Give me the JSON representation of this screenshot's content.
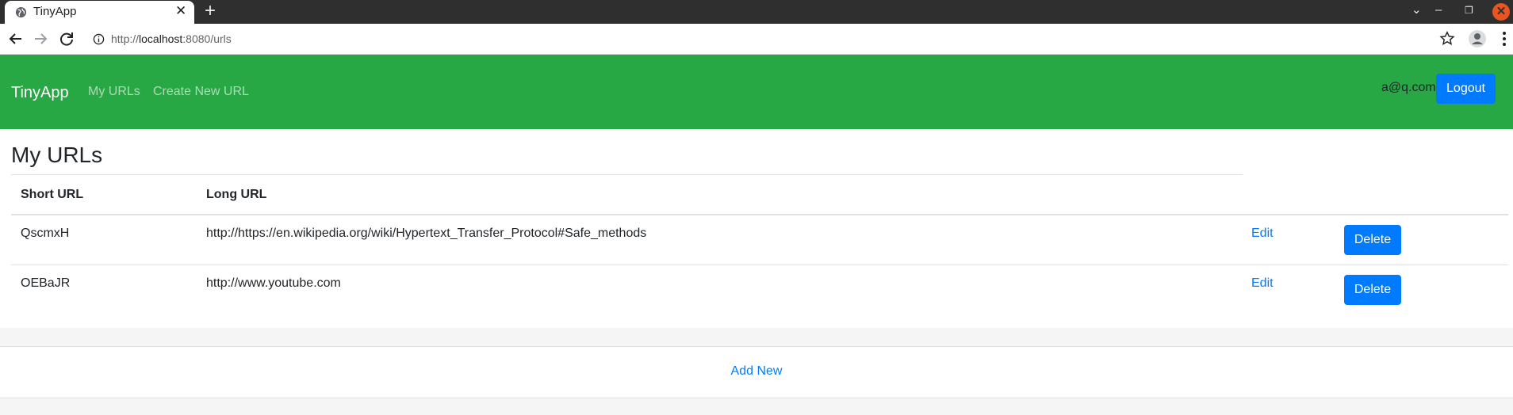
{
  "browser": {
    "tab_title": "TinyApp",
    "tab_close": "✕",
    "new_tab": "+",
    "url_scheme": "http://",
    "url_host": "localhost",
    "url_rest": ":8080/urls",
    "window_controls": {
      "dropdown": "⌄",
      "minimize": "–",
      "restore": "❐",
      "close": "✕"
    }
  },
  "navbar": {
    "brand": "TinyApp",
    "links": [
      "My URLs",
      "Create New URL"
    ],
    "user_email": "a@q.com",
    "logout_label": "Logout",
    "color": "#28a745"
  },
  "main": {
    "heading": "My URLs",
    "columns": [
      "Short URL",
      "Long URL"
    ],
    "rows": [
      {
        "short": "QscmxH",
        "long": "http://https://en.wikipedia.org/wiki/Hypertext_Transfer_Protocol#Safe_methods",
        "edit": "Edit",
        "delete": "Delete"
      },
      {
        "short": "OEBaJR",
        "long": "http://www.youtube.com",
        "edit": "Edit",
        "delete": "Delete"
      }
    ]
  },
  "footer": {
    "add_new": "Add New"
  },
  "colors": {
    "primary": "#007bff",
    "success": "#28a745",
    "chrome_dark": "#2f2f2f"
  }
}
